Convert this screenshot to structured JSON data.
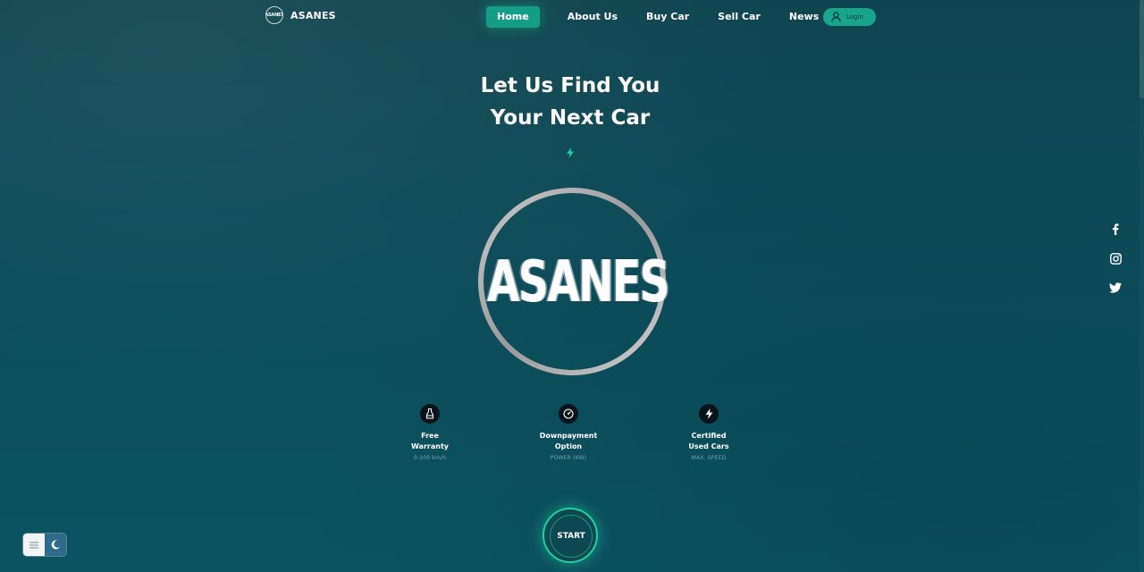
{
  "brand": {
    "logo_text": "ASANES",
    "name": "ASANES"
  },
  "nav": {
    "items": [
      {
        "label": "Home",
        "active": true
      },
      {
        "label": "About Us",
        "active": false
      },
      {
        "label": "Buy Car",
        "active": false
      },
      {
        "label": "Sell Car",
        "active": false
      },
      {
        "label": "News",
        "active": false
      }
    ],
    "login_label": "Login"
  },
  "hero": {
    "title_line1": "Let Us Find You",
    "title_line2": "Your Next Car",
    "emblem_text": "ASANES"
  },
  "features": [
    {
      "icon": "bottle-icon",
      "title_line1": "Free",
      "title_line2": "Warranty",
      "subtitle": "0-100 km/h"
    },
    {
      "icon": "gauge-icon",
      "title_line1": "Downpayment",
      "title_line2": "Option",
      "subtitle": "POWER (KW)"
    },
    {
      "icon": "bolt-icon",
      "title_line1": "Certified",
      "title_line2": "Used Cars",
      "subtitle": "MAX. SPEED"
    }
  ],
  "start_label": "START",
  "socials": [
    "facebook-icon",
    "instagram-icon",
    "twitter-icon"
  ],
  "colors": {
    "accent": "#159e86",
    "glow": "#1fd19f",
    "background": "#0c4e5b"
  }
}
